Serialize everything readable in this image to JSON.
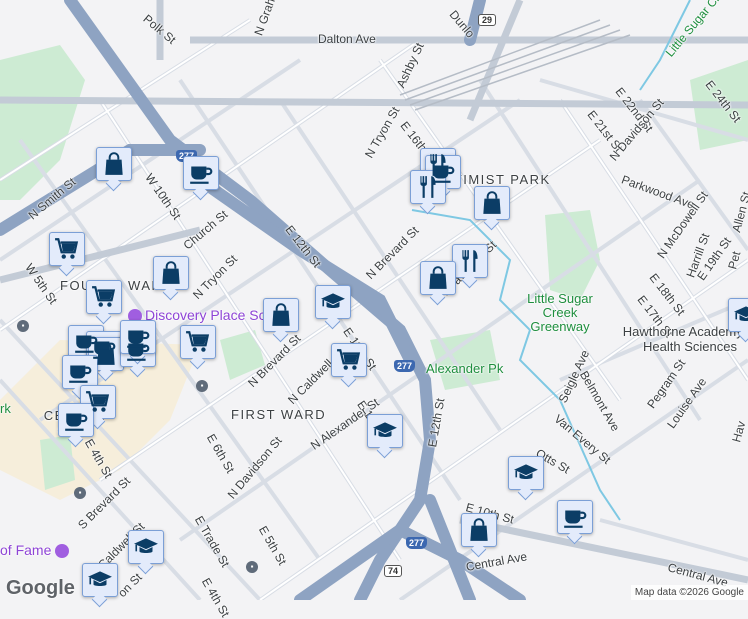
{
  "map": {
    "streets": {
      "dalton": "Dalton Ave",
      "n_graham": "N Graham St",
      "polk": "Polk St",
      "dunlo": "Dunlo",
      "ashby": "Ashby St",
      "n_tryon_upper": "N Tryon St",
      "e16": "E 16th St",
      "e21": "E 21st St",
      "e22": "E 22nd St",
      "e24": "E 24th St",
      "n_davidson_upper": "N Davidson St",
      "parkwood": "Parkwood Ave",
      "allen": "Allen St",
      "n_mcdowell": "N McDowell St",
      "harrill": "Harrill St",
      "e19": "E 19th St",
      "e18": "E 18th St",
      "e17": "E 17th St",
      "n_smith": "N Smith St",
      "w10": "W 10th St",
      "church": "Church St",
      "w5": "W 5th St",
      "n_tryon": "N Tryon St",
      "e12": "E 12th St",
      "n_brevard_upper": "N Brevard St",
      "n_davidson_mid": "N Davidson St",
      "e11": "E 11th St",
      "n_brevard": "N Brevard St",
      "n_caldwell": "N Caldwell St",
      "e10_upper": "E 10th St",
      "n_alexander": "N Alexander St",
      "e12_lower": "E 12th St",
      "seigle": "Seigle Ave",
      "belmont": "Belmont Ave",
      "van_every": "Van Every St",
      "pegram": "Pegram St",
      "louise": "Louise Ave",
      "otts": "Otts St",
      "e6": "E 6th St",
      "n_davidson_low": "N Davidson St",
      "e4": "E 4th St",
      "s_brevard": "S Brevard St",
      "e_trade": "E Trade St",
      "e5": "E 5th St",
      "e4_low": "E 4th St",
      "caldwell": "Caldwell St",
      "on_st": "on St",
      "e10": "E 10th St",
      "central_mid": "Central Ave",
      "central_right": "Central Ave",
      "little_sugar": "Little Sugar Cr",
      "pet": "Pet",
      "hav": "Hav"
    },
    "neighborhoods": {
      "fourth_ward": "FOURTH WARD",
      "first_ward": "FIRST WARD",
      "optimist_park": "OPTIMIST PARK",
      "center_city": "CENTER CITY"
    },
    "pois": {
      "discovery": "Discovery Place Sc",
      "hall_of_fame": "of Fame",
      "greenway": "Little Sugar Creek Greenway",
      "alexander_pk": "Alexander Pk",
      "hawthorne": "Hawthorne Academy of Health Sciences",
      "rk": "rk"
    },
    "shields": {
      "i277_top": "277",
      "i277_mid": "277",
      "i277_low": "277",
      "us74": "74",
      "us29": "29"
    },
    "attribution": "Map data ©2026 Google",
    "logo": "Google"
  }
}
